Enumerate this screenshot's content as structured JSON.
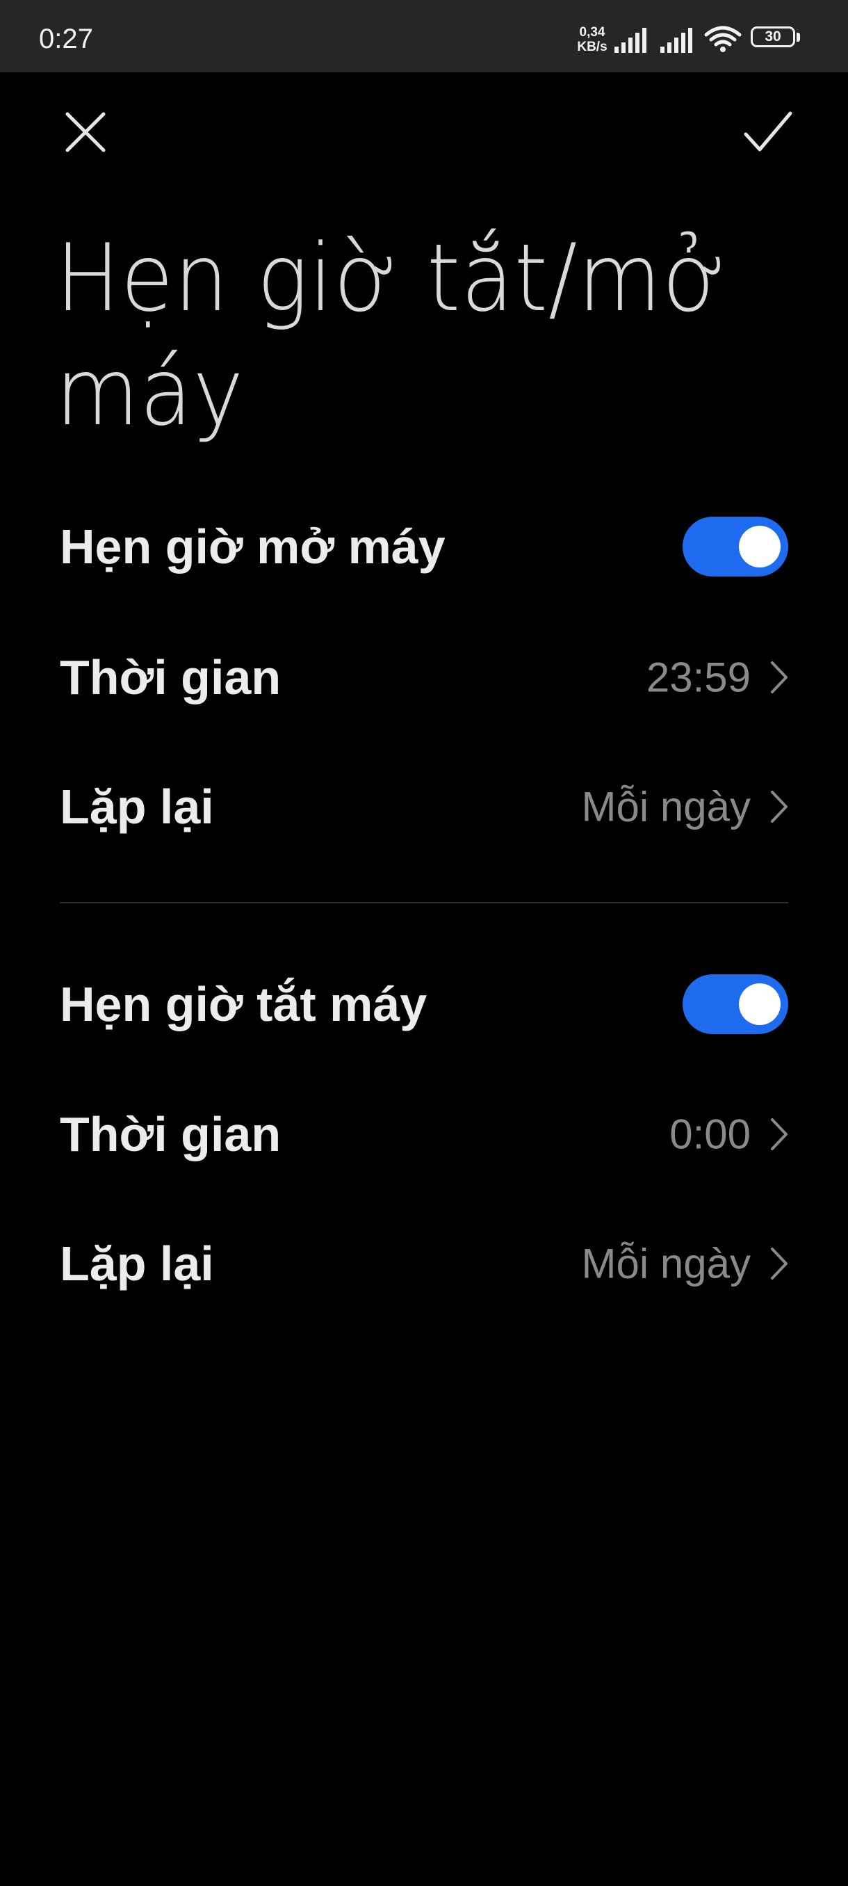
{
  "status_bar": {
    "time": "0:27",
    "net_speed_value": "0,34",
    "net_speed_unit": "KB/s",
    "battery_level": "30"
  },
  "page": {
    "title": "Hẹn giờ tắt/mở máy"
  },
  "power_on": {
    "label": "Hẹn giờ mở máy",
    "enabled": true,
    "time_label": "Thời gian",
    "time_value": "23:59",
    "repeat_label": "Lặp lại",
    "repeat_value": "Mỗi ngày"
  },
  "power_off": {
    "label": "Hẹn giờ tắt máy",
    "enabled": true,
    "time_label": "Thời gian",
    "time_value": "0:00",
    "repeat_label": "Lặp lại",
    "repeat_value": "Mỗi ngày"
  },
  "colors": {
    "toggle_on": "#1f6bf0",
    "background": "#000000",
    "status_bar": "#262626"
  }
}
